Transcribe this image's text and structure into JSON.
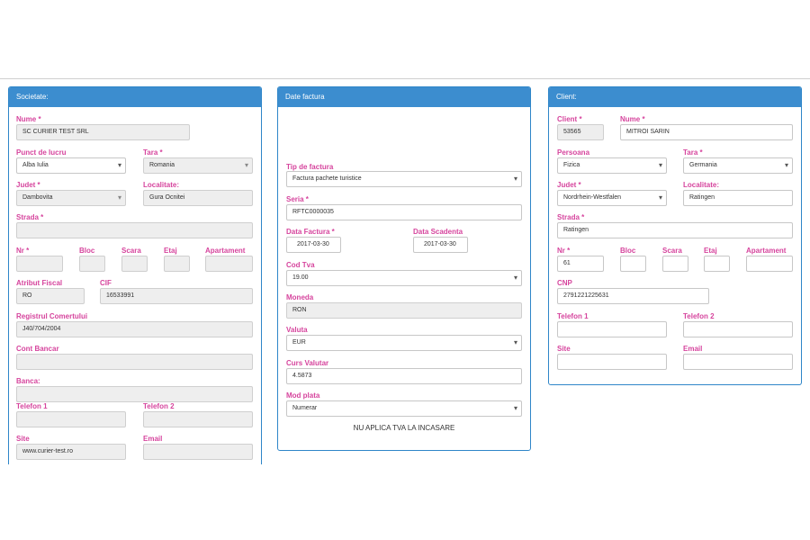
{
  "societate": {
    "title": "Societate:",
    "nume_label": "Nume *",
    "nume": "SC CURIER TEST SRL",
    "punct_label": "Punct de lucru",
    "punct": "Alba Iulia",
    "tara_label": "Tara *",
    "tara": "Romania",
    "judet_label": "Judet *",
    "judet": "Dambovita",
    "localitate_label": "Localitate:",
    "localitate": "Gura Ocnitei",
    "strada_label": "Strada *",
    "strada": "",
    "nr_label": "Nr *",
    "bloc_label": "Bloc",
    "scara_label": "Scara",
    "etaj_label": "Etaj",
    "apartament_label": "Apartament",
    "atribut_label": "Atribut Fiscal",
    "atribut": "RO",
    "cif_label": "CIF",
    "cif": "16533991",
    "registru_label": "Registrul Comertului",
    "registru": "J40/704/2004",
    "cont_label": "Cont Bancar",
    "cont": "",
    "banca_label": "Banca:",
    "banca": "",
    "telefon1_label": "Telefon 1",
    "telefon1": "",
    "telefon2_label": "Telefon 2",
    "telefon2": "",
    "site_label": "Site",
    "site": "www.curier-test.ro",
    "email_label": "Email",
    "email": ""
  },
  "factura": {
    "title": "Date factura",
    "tip_label": "Tip de factura",
    "tip": "Factura pachete turistice",
    "seria_label": "Seria *",
    "seria": "RFTC0000035",
    "data_label": "Data Factura *",
    "data": "2017-03-30",
    "scadenta_label": "Data Scadenta",
    "scadenta": "2017-03-30",
    "tva_label": "Cod Tva",
    "tva": "19.00",
    "moneda_label": "Moneda",
    "moneda": "RON",
    "valuta_label": "Valuta",
    "valuta": "EUR",
    "curs_label": "Curs Valutar",
    "curs": "4.5873",
    "plata_label": "Mod plata",
    "plata": "Numerar",
    "note": "NU APLICA TVA LA INCASARE"
  },
  "client": {
    "title": "Client:",
    "client_label": "Client *",
    "client": "53565",
    "nume_label": "Nume *",
    "nume": "MITROI SARIN",
    "persoana_label": "Persoana",
    "persoana": "Fizica",
    "tara_label": "Tara *",
    "tara": "Germania",
    "judet_label": "Judet *",
    "judet": "Nordrhein-Westfalen",
    "localitate_label": "Localitate:",
    "localitate": "Ratingen",
    "strada_label": "Strada *",
    "strada": "Ratingen",
    "nr_label": "Nr *",
    "nr": "61",
    "bloc_label": "Bloc",
    "scara_label": "Scara",
    "etaj_label": "Etaj",
    "apartament_label": "Apartament",
    "cnp_label": "CNP",
    "cnp": "2791221225631",
    "telefon1_label": "Telefon 1",
    "telefon2_label": "Telefon 2",
    "site_label": "Site",
    "email_label": "Email"
  }
}
